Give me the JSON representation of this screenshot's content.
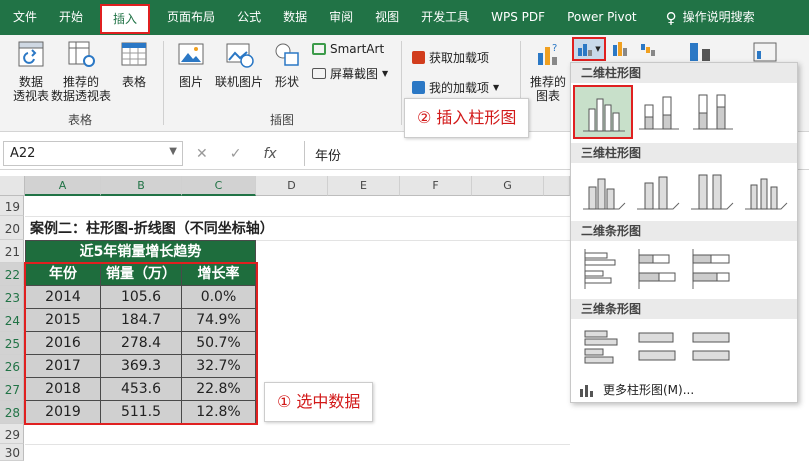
{
  "ribbon_tabs": [
    "文件",
    "开始",
    "插入",
    "页面布局",
    "公式",
    "数据",
    "审阅",
    "视图",
    "开发工具",
    "WPS PDF",
    "Power Pivot"
  ],
  "active_tab": "插入",
  "tell_me": "操作说明搜索",
  "ribbon": {
    "pivot_table": "数据\n透视表",
    "recommended_pivot": "推荐的\n数据透视表",
    "table": "表格",
    "group_tables": "表格",
    "picture": "图片",
    "online_picture": "联机图片",
    "shapes": "形状",
    "smartart": "SmartArt",
    "screenshot": "屏幕截图",
    "group_illustrations": "插图",
    "get_addins": "获取加载项",
    "my_addins": "我的加载项",
    "recommended_charts": "推荐的\n图表"
  },
  "formula_bar": {
    "name_box": "A22",
    "formula": "年份",
    "fx": "fx"
  },
  "columns": [
    "A",
    "B",
    "C",
    "D",
    "E",
    "F",
    "G"
  ],
  "rows": [
    "19",
    "20",
    "21",
    "22",
    "23",
    "24",
    "25",
    "26",
    "27",
    "28",
    "29",
    "30"
  ],
  "sheet": {
    "case_title": "案例二：柱形图-折线图（不同坐标轴）",
    "table_title": "近5年销量增长趋势",
    "headers": [
      "年份",
      "销量（万）",
      "增长率"
    ],
    "rows": [
      [
        "2014",
        "105.6",
        "0.0%"
      ],
      [
        "2015",
        "184.7",
        "74.9%"
      ],
      [
        "2016",
        "278.4",
        "50.7%"
      ],
      [
        "2017",
        "369.3",
        "32.7%"
      ],
      [
        "2018",
        "453.6",
        "22.8%"
      ],
      [
        "2019",
        "511.5",
        "12.8%"
      ]
    ]
  },
  "dropdown": {
    "sec_2d_column": "二维柱形图",
    "sec_3d_column": "三维柱形图",
    "sec_2d_bar": "二维条形图",
    "sec_3d_bar": "三维条形图",
    "more": "更多柱形图(M)..."
  },
  "callouts": {
    "step1": "① 选中数据",
    "step2": "② 插入柱形图"
  },
  "colors": {
    "excel_green": "#217346",
    "highlight_red": "#e02020",
    "table_header": "#1e6d3d",
    "cell_fill": "#d0d0d0"
  }
}
